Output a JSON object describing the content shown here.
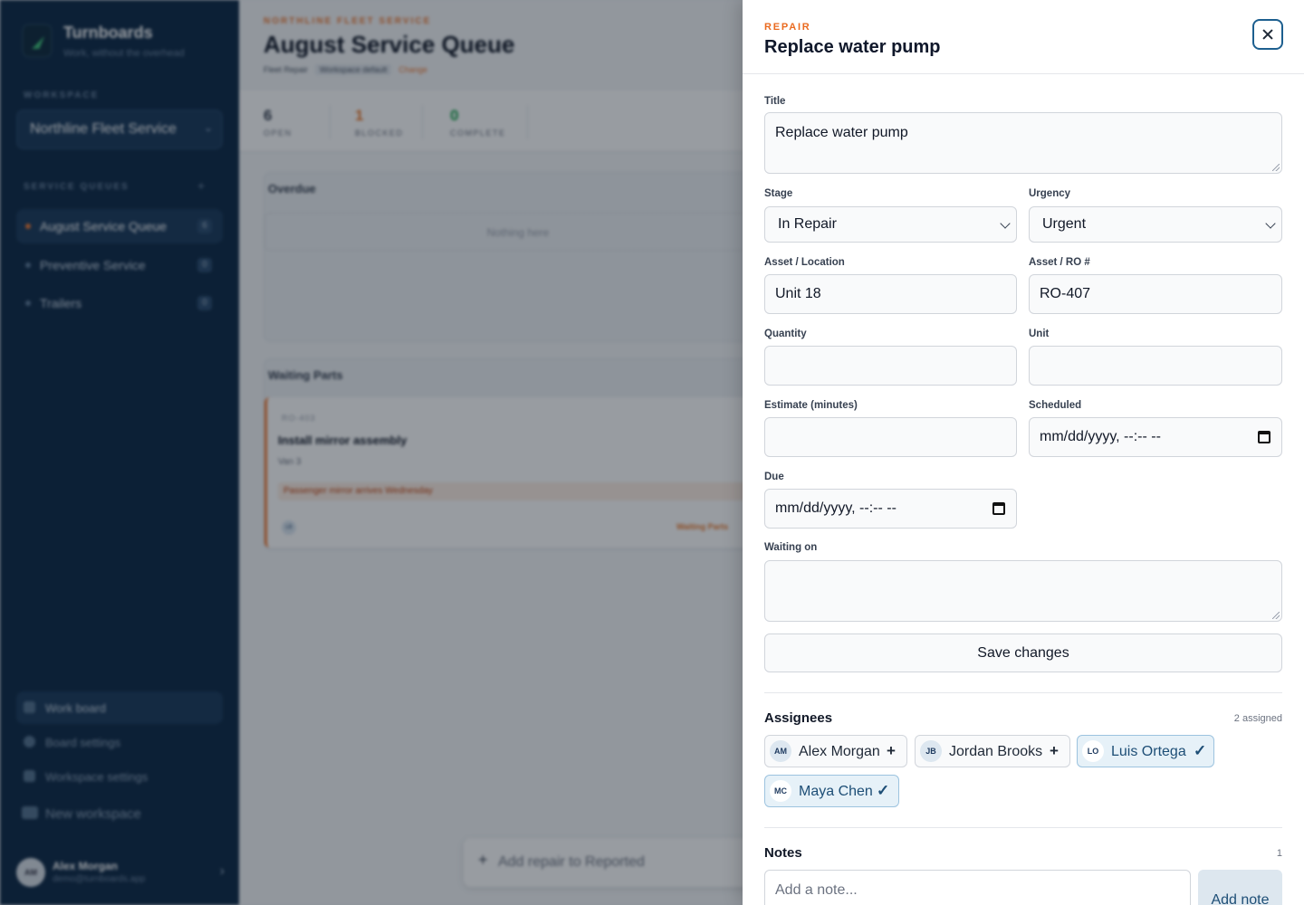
{
  "sidebar": {
    "brand_name": "Turnboards",
    "brand_tagline": "Work, without the overhead",
    "workspace_label": "WORKSPACE",
    "workspace_value": "Northline Fleet Service",
    "queues_label": "SERVICE QUEUES",
    "queues": [
      {
        "label": "August Service Queue",
        "count": "6"
      },
      {
        "label": "Preventive Service",
        "count": "0"
      },
      {
        "label": "Trailers",
        "count": "0"
      }
    ],
    "nav": [
      {
        "label": "Work board",
        "icon": "calendar-icon"
      },
      {
        "label": "Board settings",
        "icon": "gear-icon"
      },
      {
        "label": "Workspace settings",
        "icon": "sliders-icon"
      },
      {
        "label": "New workspace",
        "icon": "truck-icon"
      }
    ],
    "user": {
      "initials": "AM",
      "name": "Alex Morgan",
      "email": "demo@turnboards.app"
    }
  },
  "main": {
    "eyebrow": "NORTHLINE FLEET SERVICE",
    "title": "August Service Queue",
    "meta_type": "Fleet Repair",
    "meta_badge": "Workspace default",
    "meta_change": "Change",
    "stats": [
      {
        "value": "6",
        "label": "OPEN",
        "color": "#374151"
      },
      {
        "value": "1",
        "label": "BLOCKED",
        "color": "#ea7a2f"
      },
      {
        "value": "0",
        "label": "COMPLETE",
        "color": "#16a34a"
      }
    ],
    "lanes": [
      {
        "title": "Overdue",
        "empty_text": "Nothing here"
      },
      {
        "title": "Waiting Parts"
      }
    ],
    "card": {
      "ro": "RO-403",
      "title": "Install mirror assembly",
      "location": "Van 3",
      "note": "Passenger mirror arrives Wednesday",
      "assignee": "LB",
      "status": "Waiting Parts"
    },
    "add_repair": "Add repair to Reported"
  },
  "drawer": {
    "eyebrow": "REPAIR",
    "title": "Replace water pump",
    "fields": {
      "title_label": "Title",
      "title_value": "Replace water pump",
      "stage_label": "Stage",
      "stage_value": "In Repair",
      "urgency_label": "Urgency",
      "urgency_value": "Urgent",
      "asset_location_label": "Asset / Location",
      "asset_location_value": "Unit 18",
      "asset_ro_label": "Asset / RO #",
      "asset_ro_value": "RO-407",
      "quantity_label": "Quantity",
      "quantity_value": "",
      "unit_label": "Unit",
      "unit_value": "",
      "estimate_label": "Estimate (minutes)",
      "estimate_value": "",
      "scheduled_label": "Scheduled",
      "scheduled_placeholder": "mm/dd/yyyy, --:-- --",
      "due_label": "Due",
      "due_placeholder": "mm/dd/yyyy, --:-- --",
      "waiting_label": "Waiting on",
      "waiting_value": ""
    },
    "save_label": "Save changes",
    "assignees": {
      "title": "Assignees",
      "meta": "2 assigned",
      "people": [
        {
          "initials": "AM",
          "name": "Alex Morgan",
          "assigned": false,
          "action": "+"
        },
        {
          "initials": "JB",
          "name": "Jordan Brooks",
          "assigned": false,
          "action": "+"
        },
        {
          "initials": "LO",
          "name": "Luis Ortega",
          "assigned": true,
          "action": "✓"
        },
        {
          "initials": "MC",
          "name": "Maya Chen",
          "assigned": true,
          "action": "✓"
        }
      ]
    },
    "notes": {
      "title": "Notes",
      "count": "1",
      "placeholder": "Add a note...",
      "add_label": "Add note"
    }
  }
}
